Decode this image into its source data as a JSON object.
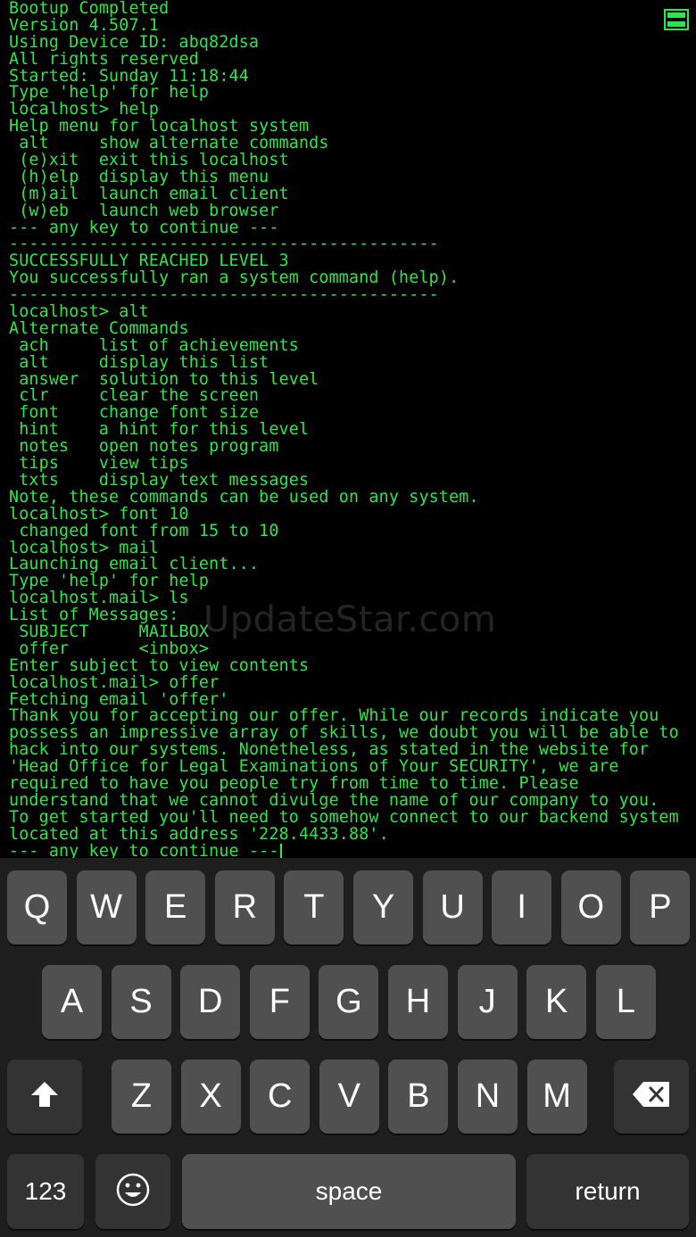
{
  "terminal": {
    "lines": [
      "Bootup Completed",
      "Version 4.507.1",
      "Using Device ID: abq82dsa",
      "All rights reserved",
      "Started: Sunday 11:18:44",
      "Type 'help' for help",
      "localhost> help",
      "Help menu for localhost system",
      " alt     show alternate commands",
      " (e)xit  exit this localhost",
      " (h)elp  display this menu",
      " (m)ail  launch email client",
      " (w)eb   launch web browser",
      "--- any key to continue ---",
      "-------------------------------------------",
      "SUCCESSFULLY REACHED LEVEL 3",
      "You successfully ran a system command (help).",
      "-------------------------------------------",
      "localhost> alt",
      "Alternate Commands",
      " ach     list of achievements",
      " alt     display this list",
      " answer  solution to this level",
      " clr     clear the screen",
      " font    change font size",
      " hint    a hint for this level",
      " notes   open notes program",
      " tips    view tips",
      " txts    display text messages",
      "Note, these commands can be used on any system.",
      "localhost> font 10",
      " changed font from 15 to 10",
      "localhost> mail",
      "Launching email client...",
      "Type 'help' for help",
      "localhost.mail> ls",
      "List of Messages:",
      " SUBJECT     MAILBOX",
      " offer       <inbox>",
      "Enter subject to view contents",
      "localhost.mail> offer",
      "Fetching email 'offer'",
      "Thank you for accepting our offer. While our records indicate you",
      "possess an impressive array of skills, we doubt you will be able to",
      "hack into our systems. Nonetheless, as stated in the website for",
      "'Head Office for Legal Examinations of Your SECURITY', we are",
      "required to have you people try from time to time. Please",
      "understand that we cannot divulge the name of our company to you.",
      "To get started you'll need to somehow connect to our backend system",
      "located at this address '228.4433.88'.",
      "--- any key to continue ---"
    ],
    "text_color": "#2ee64a",
    "menu_icon": "hamburger-menu-icon"
  },
  "watermark": "UpdateStar.com",
  "keyboard": {
    "row1": [
      "Q",
      "W",
      "E",
      "R",
      "T",
      "Y",
      "U",
      "I",
      "O",
      "P"
    ],
    "row2": [
      "A",
      "S",
      "D",
      "F",
      "G",
      "H",
      "J",
      "K",
      "L"
    ],
    "row3": [
      "Z",
      "X",
      "C",
      "V",
      "B",
      "N",
      "M"
    ],
    "shift_icon": "shift-arrow-icon",
    "delete_icon": "backspace-icon",
    "emoji_icon": "emoji-smiley-icon",
    "numbers_label": "123",
    "space_label": "space",
    "return_label": "return"
  }
}
